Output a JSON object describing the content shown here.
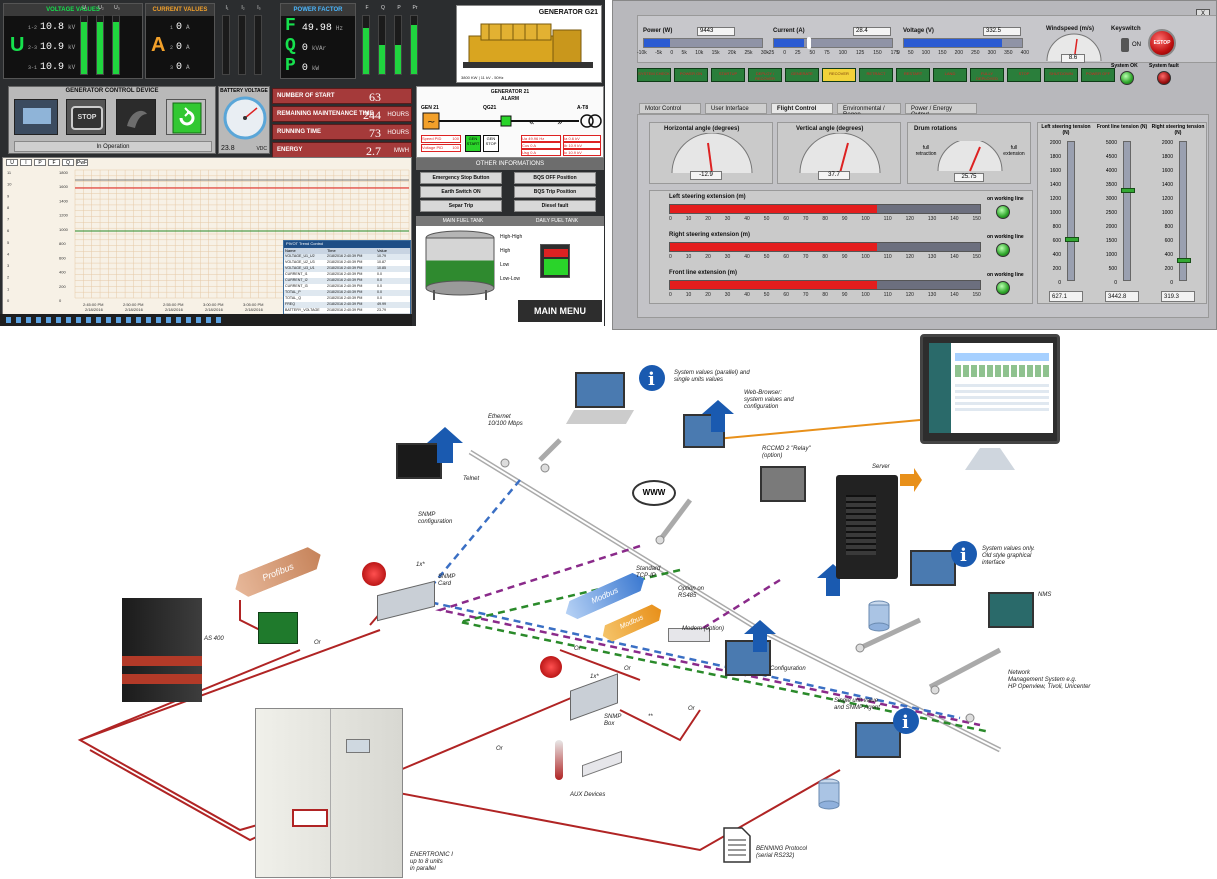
{
  "generator": {
    "voltage": {
      "title": "VOLTAGE VALUES",
      "letter": "U",
      "rows": [
        {
          "phase": "1-2",
          "value": "10.8",
          "unit": "kV"
        },
        {
          "phase": "2-3",
          "value": "10.9",
          "unit": "kV"
        },
        {
          "phase": "3-1",
          "value": "10.9",
          "unit": "kV"
        }
      ],
      "bar_labels": [
        "U₁",
        "U₂",
        "U₃"
      ]
    },
    "current": {
      "title": "CURRENT VALUES",
      "letter": "A",
      "rows": [
        {
          "phase": "1",
          "value": "0",
          "unit": "A"
        },
        {
          "phase": "2",
          "value": "0",
          "unit": "A"
        },
        {
          "phase": "3",
          "value": "0",
          "unit": "A"
        }
      ],
      "bar_labels": [
        "I₁",
        "I₂",
        "I₃"
      ]
    },
    "power": {
      "title": "POWER FACTOR",
      "rows": [
        {
          "letter": "F",
          "value": "49.98",
          "unit": "Hz"
        },
        {
          "letter": "Q",
          "value": "0",
          "unit": "kVAr"
        },
        {
          "letter": "P",
          "value": "0",
          "unit": "kW"
        }
      ],
      "bar_labels": [
        "F",
        "Q",
        "P",
        "Pr"
      ]
    },
    "image_title": "GENERATOR G21",
    "image_caption": "3800 KW | 11 kV - 50Hz",
    "control_device": {
      "title": "GENERATOR CONTROL DEVICE",
      "stop_label": "STOP",
      "status": "In Operation"
    },
    "battery": {
      "title": "BATTERY VOLTAGE",
      "value": "23.8",
      "unit": "VDC"
    },
    "info": [
      {
        "label": "NUMBER OF START",
        "value": "63",
        "unit": ""
      },
      {
        "label": "REMAINING MAINTENANCE TIME",
        "value": "244",
        "unit": "HOURS"
      },
      {
        "label": "RUNNING TIME",
        "value": "73",
        "unit": "HOURS"
      },
      {
        "label": "ENERGY",
        "value": "2.7",
        "unit": "MWH"
      }
    ],
    "alarm": {
      "title": "GENERATOR 21",
      "subtitle": "ALARM"
    },
    "single_line": {
      "gen_label": "GEN 21",
      "qg_label": "QG21",
      "tr_label": "A-T8",
      "speed_label": "Speed PID",
      "speed_val": "100",
      "voltage_label": "Voltage PID",
      "voltage_val": "100",
      "gen_btn": "GEN START",
      "stop_btn": "GEN STOP",
      "readings": [
        {
          "label": "Ua",
          "value": "49.96",
          "unit": "Hz"
        },
        {
          "label": "Cos",
          "value": "0",
          "unit": "A"
        },
        {
          "label": "Usg",
          "value": "0",
          "unit": "A"
        }
      ],
      "readings_right": [
        {
          "label": "Ia",
          "value": "0.6",
          "unit": "kV"
        },
        {
          "label": "Ib",
          "value": "10.9",
          "unit": "kV"
        },
        {
          "label": "Ic",
          "value": "10.9",
          "unit": "kV"
        }
      ]
    },
    "other_title": "OTHER INFORMATIONS",
    "other_buttons": [
      "Emergency Stop Button",
      "BQS OFF Position",
      "Earth Switch ON",
      "BQS Trip Position",
      "Separ Trip",
      "Diesel fault"
    ],
    "fuel_titles": [
      "MAIN FUEL TANK",
      "DAILY FUEL TANK"
    ],
    "tank_levels": [
      "High-High",
      "High",
      "Low",
      "Low-Low"
    ],
    "main_fuel_level": 0.55,
    "main_menu": "MAIN MENU",
    "trend_headers": [
      "U",
      "I",
      "P",
      "F",
      "Q",
      "PwF"
    ],
    "trend_y_ticks": [
      "11",
      "10",
      "9",
      "8",
      "7",
      "6",
      "5",
      "4",
      "3",
      "2",
      "1",
      "0"
    ],
    "trend_y_ticks2": [
      "1800",
      "1600",
      "1400",
      "1200",
      "1000",
      "800",
      "600",
      "400",
      "200",
      "0"
    ],
    "trend_x_ticks": [
      "2:45:00 PM\n2/18/2016",
      "2:50:00 PM\n2/18/2016",
      "2:55:00 PM\n2/18/2016",
      "3:00:00 PM\n2/18/2016",
      "3:05:00 PM\n2/18/2016",
      "3:10:00 PM\n2/18/2016",
      "3:15:00 PM\n2/18/2016",
      "3:20:00 PM\n2/18/2016"
    ],
    "trend_table": {
      "title": "PIVOT Trend Control",
      "headers": [
        "Name",
        "Time",
        "Value"
      ],
      "rows": [
        [
          "VOLTAGE_U1_U2",
          "2/18/2016 2:40:39 PM",
          "10.79"
        ],
        [
          "VOLTAGE_U2_U3",
          "2/18/2016 2:40:39 PM",
          "10.87"
        ],
        [
          "VOLTAGE_U3_U1",
          "2/18/2016 2:40:39 PM",
          "10.85"
        ],
        [
          "CURRENT_I1",
          "2/18/2016 2:40:39 PM",
          "0.0"
        ],
        [
          "CURRENT_I2",
          "2/18/2016 2:40:39 PM",
          "0.0"
        ],
        [
          "CURRENT_I3",
          "2/18/2016 2:40:39 PM",
          "0.0"
        ],
        [
          "TOTAL_P",
          "2/18/2016 2:40:39 PM",
          "0.0"
        ],
        [
          "TOTAL_Q",
          "2/18/2016 2:40:39 PM",
          "0.0"
        ],
        [
          "FREQ",
          "2/18/2016 2:40:39 PM",
          "49.99"
        ],
        [
          "BATTERY_VOLTAGE",
          "2/18/2016 2:40:39 PM",
          "23.79"
        ]
      ]
    }
  },
  "steering": {
    "close": "X",
    "power": {
      "label": "Power (W)",
      "value": "9443",
      "ticks": [
        "-10k",
        "-5k",
        "0",
        "5k",
        "10k",
        "15k",
        "20k",
        "25k",
        "30k"
      ]
    },
    "current": {
      "label": "Current (A)",
      "value": "28.4",
      "ticks": [
        "-25",
        "0",
        "25",
        "50",
        "75",
        "100",
        "125",
        "150",
        "175"
      ]
    },
    "voltage": {
      "label": "Voltage (V)",
      "value": "332.5",
      "ticks": [
        "0",
        "50",
        "100",
        "150",
        "200",
        "250",
        "300",
        "350",
        "400"
      ]
    },
    "windspeed": {
      "label": "Windspeed (m/s)",
      "value": "8.6",
      "ticks": [
        "2.5",
        "5",
        "7.5",
        "10",
        "12.5",
        "0",
        "15"
      ]
    },
    "keyswitch": {
      "label": "Keyswitch",
      "state": "ON"
    },
    "estop": "ESTOP",
    "status": [
      {
        "label": "System OK"
      },
      {
        "label": "System fault"
      }
    ],
    "buttons": [
      "SYSTEM CHECK",
      "POWER ON",
      "STARTUP",
      "DEPLOY / RECOVER",
      "GENERATE",
      "RECOVER",
      "RETRACT",
      "RESTART",
      "LAND",
      "FULLY DEPLOYED",
      "STOP",
      "SHUTDOWN",
      "POWER OFF"
    ],
    "active_button_index": 5,
    "tabs": [
      "Motor Control",
      "User Interface",
      "Flight Control",
      "Environmental / Regen",
      "Power / Energy Output"
    ],
    "active_tab_index": 2,
    "h_angle": {
      "label": "Horizontal angle (degrees)",
      "value": "-12.9",
      "ticks": [
        "-90",
        "-75",
        "-60",
        "-45",
        "-30",
        "-15",
        "0",
        "15",
        "30",
        "45",
        "60",
        "75",
        "90"
      ]
    },
    "v_angle": {
      "label": "Vertical angle (degrees)",
      "value": "37.7",
      "ticks": [
        "-90",
        "-75",
        "-60",
        "-45",
        "-30",
        "-15",
        "0",
        "15",
        "30",
        "45",
        "60",
        "75",
        "90"
      ]
    },
    "drum": {
      "label": "Drum rotations",
      "left": "full retraction",
      "right": "full extension",
      "value": "25.75"
    },
    "extensions": [
      {
        "label": "Left steering extension (m)",
        "value": 100,
        "status": "on working line"
      },
      {
        "label": "Right steering extension (m)",
        "value": 100,
        "status": "on working line"
      },
      {
        "label": "Front line extension (m)",
        "value": 100,
        "status": "on working line"
      }
    ],
    "ext_ticks": [
      "0",
      "10",
      "20",
      "30",
      "40",
      "50",
      "60",
      "70",
      "80",
      "90",
      "100",
      "110",
      "120",
      "130",
      "140",
      "150"
    ],
    "tensions": [
      {
        "label": "Left steering tension (N)",
        "value": "627.1",
        "fraction": 0.31
      },
      {
        "label": "Front line tension (N)",
        "value": "3442.8",
        "fraction": 0.66
      },
      {
        "label": "Right steering tension (N)",
        "value": "319.3",
        "fraction": 0.16
      }
    ],
    "tension_ticks_left": [
      "2000",
      "1800",
      "1600",
      "1400",
      "1200",
      "1000",
      "800",
      "600",
      "400",
      "200",
      "0"
    ],
    "tension_ticks_front": [
      "5000",
      "4500",
      "4000",
      "3500",
      "3000",
      "2500",
      "2000",
      "1500",
      "1000",
      "500",
      "0"
    ],
    "tension_ticks_right": [
      "2000",
      "1800",
      "1600",
      "1400",
      "1200",
      "1000",
      "800",
      "600",
      "400",
      "200",
      "0"
    ]
  },
  "network": {
    "labels": {
      "system_values": "System values (parallel) and\nsingle units values",
      "web_browser": "Web-Browser:\nsystem values and\nconfiguration",
      "ethernet": "Ethernet\n10/100 Mbps",
      "telnet": "Telnet",
      "snmp_config": "SNMP\nconfiguration",
      "rccmd": "RCCMD 2 \"Relay\"\n(option)",
      "server": "Server",
      "www": "WWW",
      "profibus": "Profibus",
      "snmp_card": "SNMP\nCard",
      "one_x": "1x*",
      "standard_tcp": "Standard\nTCP-IP",
      "modbus1": "Modbus",
      "modbus2": "Modbus",
      "option_rs485": "Option on\nRS485",
      "as400": "AS 400",
      "or": "Or",
      "modem": "Modem (option)",
      "configuration": "Configuration",
      "snmp_box": "SNMP\nBox",
      "one_x_box": "1x*",
      "double_star": "**",
      "system_values_only": "System values only.\nOld style graphical\ninterface",
      "nms": "NMS",
      "network_mgmt": "Network\nManagement System e.g.\nHP Openview, Tivoli, Unicenter",
      "single_unit": "Single unit value\nand SNMP Agent",
      "aux": "AUX Devices",
      "benning": "BENNING Protocol\n(serial RS232)",
      "enertronic": "ENERTRONIC I\nup to 8 units\nin parallel"
    }
  }
}
